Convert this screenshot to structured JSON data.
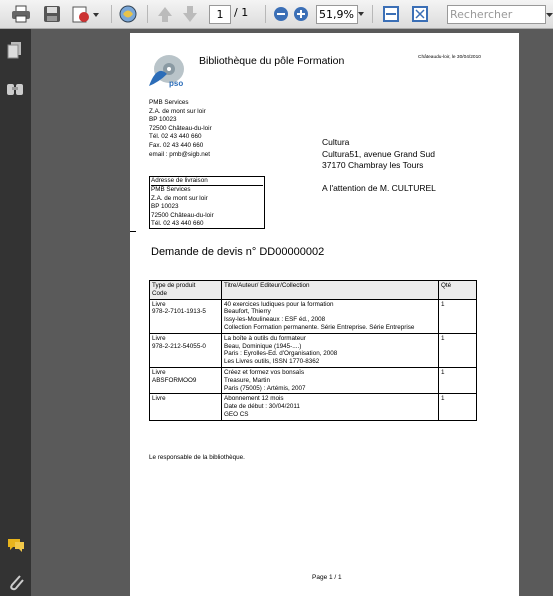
{
  "toolbar": {
    "page_current": "1",
    "page_total": "/ 1",
    "zoom": "51,9%",
    "search_placeholder": "Rechercher"
  },
  "document": {
    "library_title": "Bibliothèque du pôle Formation",
    "place_date": "Châteaudu-loir, le 30/04/2010",
    "logo_text": "pso",
    "sender": [
      "PMB Services",
      "Z.A. de mont sur loir",
      "BP 10023",
      "72500 Château-du-loir",
      "Tél. 02 43 440 660",
      "Fax. 02 43 440 660",
      "email : pmb@sigb.net"
    ],
    "recipient": [
      "Cultura",
      "Cultura51, avenue Grand Sud",
      "37170 Chambray les Tours"
    ],
    "attention": "A l'attention de M. CULTUREL",
    "delivery_title": "Adresse de livraison",
    "delivery": [
      "PMB Services",
      "Z.A. de mont sur loir",
      "BP 10023",
      "72500 Château-du-loir",
      "Tél. 02 43 440 660"
    ],
    "quote_title": "Demande de devis n° DD00000002",
    "table": {
      "headers": [
        "Type de produit\nCode",
        "Titre/Auteur/ Editeur/Collection",
        "Qté"
      ],
      "rows": [
        {
          "type": "Livre",
          "code": "978-2-7101-1913-5",
          "details": [
            "40 exercices ludiques pour la formation",
            "Beaufort, Thierry",
            "Issy-les-Moulineaux : ESF éd., 2008",
            "Collection Formation permanente. Série Entreprise. Série Entreprise"
          ],
          "qty": "1"
        },
        {
          "type": "Livre",
          "code": "978-2-212-54055-0",
          "details": [
            "La boîte à outils du formateur",
            "Beau, Dominique  (1945-....)",
            "Paris : Eyrolles-Ed. d'Organisation, 2008",
            "Les Livres outils, ISSN 1770-8362"
          ],
          "qty": "1"
        },
        {
          "type": "Livre",
          "code": "ABSFORMOO9",
          "details": [
            "Créez et formez vos bonsaïs",
            "Treasure, Martin",
            "Paris (75005) : Artémis, 2007"
          ],
          "qty": "1"
        },
        {
          "type": "Livre",
          "code": "",
          "details": [
            "Abonnement 12 mois",
            "Date de début : 30/04/2011",
            "GEO CS"
          ],
          "qty": "1"
        }
      ]
    },
    "signature": "Le responsable de la bibliothèque.",
    "footer": "Page 1 / 1"
  }
}
